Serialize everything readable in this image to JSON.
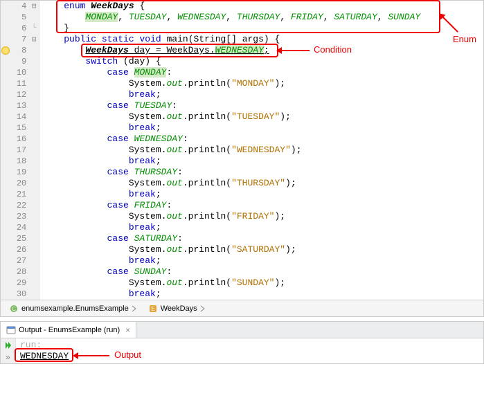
{
  "annotations": {
    "enum": "Enum",
    "condition": "Condition",
    "output": "Output"
  },
  "breadcrumb": {
    "item1": "enumsexample.EnumsExample",
    "item2": "WeekDays"
  },
  "output": {
    "tab_title": "Output - EnumsExample (run)",
    "run_label": "run:",
    "result": "WEDNESDAY"
  },
  "code": {
    "l4": {
      "enum": "enum",
      "name": "WeekDays",
      "brace": " {"
    },
    "l5": {
      "mon": "MONDAY",
      "tue": "TUESDAY",
      "wed": "WEDNESDAY",
      "thu": "THURSDAY",
      "fri": "FRIDAY",
      "sat": "SATURDAY",
      "sun": "SUNDAY",
      "c": ", "
    },
    "l6": {
      "brace": "}"
    },
    "l7": {
      "public": "public",
      "static": "static",
      "void": "void",
      "main": " main(String[] args) {"
    },
    "l8": {
      "type": "WeekDays",
      "var": " day = WeekDays.",
      "val": "WEDNESDAY",
      "semi": ";"
    },
    "l9": {
      "switch": "switch",
      "rest": " (day) {"
    },
    "l10": {
      "case": "case",
      "v": "MONDAY",
      "colon": ":"
    },
    "l11": {
      "sys": "System.",
      "out": "out",
      "rest": ".println(",
      "str": "\"MONDAY\"",
      "end": ");"
    },
    "l12": {
      "break": "break",
      "semi": ";"
    },
    "l13": {
      "case": "case",
      "v": "TUESDAY",
      "colon": ":"
    },
    "l14": {
      "sys": "System.",
      "out": "out",
      "rest": ".println(",
      "str": "\"TUESDAY\"",
      "end": ");"
    },
    "l15": {
      "break": "break",
      "semi": ";"
    },
    "l16": {
      "case": "case",
      "v": "WEDNESDAY",
      "colon": ":"
    },
    "l17": {
      "sys": "System.",
      "out": "out",
      "rest": ".println(",
      "str": "\"WEDNESDAY\"",
      "end": ");"
    },
    "l18": {
      "break": "break",
      "semi": ";"
    },
    "l19": {
      "case": "case",
      "v": "THURSDAY",
      "colon": ":"
    },
    "l20": {
      "sys": "System.",
      "out": "out",
      "rest": ".println(",
      "str": "\"THURSDAY\"",
      "end": ");"
    },
    "l21": {
      "break": "break",
      "semi": ";"
    },
    "l22": {
      "case": "case",
      "v": "FRIDAY",
      "colon": ":"
    },
    "l23": {
      "sys": "System.",
      "out": "out",
      "rest": ".println(",
      "str": "\"FRIDAY\"",
      "end": ");"
    },
    "l24": {
      "break": "break",
      "semi": ";"
    },
    "l25": {
      "case": "case",
      "v": "SATURDAY",
      "colon": ":"
    },
    "l26": {
      "sys": "System.",
      "out": "out",
      "rest": ".println(",
      "str": "\"SATURDAY\"",
      "end": ");"
    },
    "l27": {
      "break": "break",
      "semi": ";"
    },
    "l28": {
      "case": "case",
      "v": "SUNDAY",
      "colon": ":"
    },
    "l29": {
      "sys": "System.",
      "out": "out",
      "rest": ".println(",
      "str": "\"SUNDAY\"",
      "end": ");"
    },
    "l30": {
      "break": "break",
      "semi": ";"
    }
  },
  "line_numbers": [
    "4",
    "5",
    "6",
    "7",
    "8",
    "9",
    "10",
    "11",
    "12",
    "13",
    "14",
    "15",
    "16",
    "17",
    "18",
    "19",
    "20",
    "21",
    "22",
    "23",
    "24",
    "25",
    "26",
    "27",
    "28",
    "29",
    "30"
  ]
}
